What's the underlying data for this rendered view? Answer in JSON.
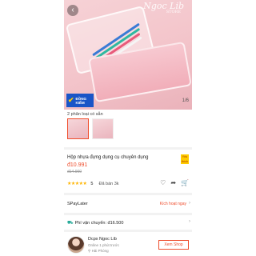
{
  "hero": {
    "watermark": "Ngoc Lib",
    "watermark_sub": "STORE",
    "image_counter": "1/6",
    "badge_line1": "ĐỒNG",
    "badge_line2": "KIỂM",
    "badge_color": "#1a55c7"
  },
  "variants": {
    "label": "2 phân loại có sẵn",
    "count": 2
  },
  "product": {
    "title": "Hộp nhựa đựng dụng cụ chuyên dụng",
    "mall_badge": "Yêu thích",
    "price": "đ10.991",
    "original_price": "đ14.900",
    "rating_stars": "★★★★★",
    "rating": "5",
    "sold": "Đã bán 3k",
    "accent_color": "#ee4d2d"
  },
  "icons": {
    "back": "‹",
    "like": "♡",
    "share": "➦",
    "cart": "🛒"
  },
  "spaylater": {
    "label": "SPayLater",
    "action": "Kích hoạt ngay"
  },
  "shipping": {
    "label": "Phí vận chuyển: đ16.500"
  },
  "shop": {
    "name": "Dcpx Ngoc Lib",
    "status": "Online 1 phút trước",
    "location": "Hải Phòng",
    "view_button": "Xem Shop"
  }
}
